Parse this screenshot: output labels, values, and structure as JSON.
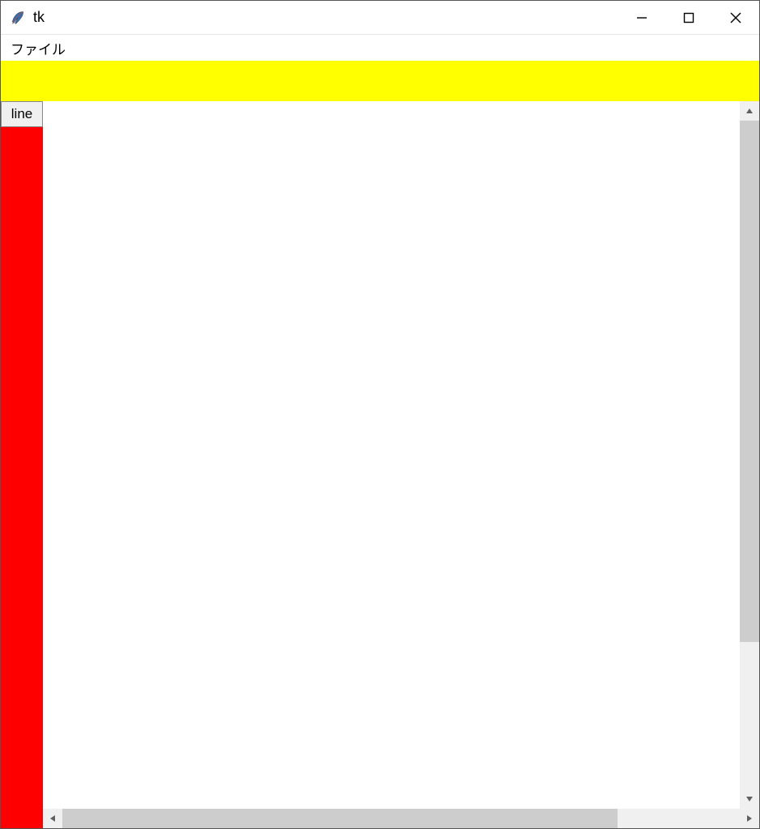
{
  "window": {
    "title": "tk"
  },
  "menubar": {
    "items": [
      {
        "label": "ファイル"
      }
    ]
  },
  "toolbar": {
    "line_button_label": "line"
  },
  "colors": {
    "toolbar_top": "#ffff00",
    "side_panel": "#ff0000"
  }
}
